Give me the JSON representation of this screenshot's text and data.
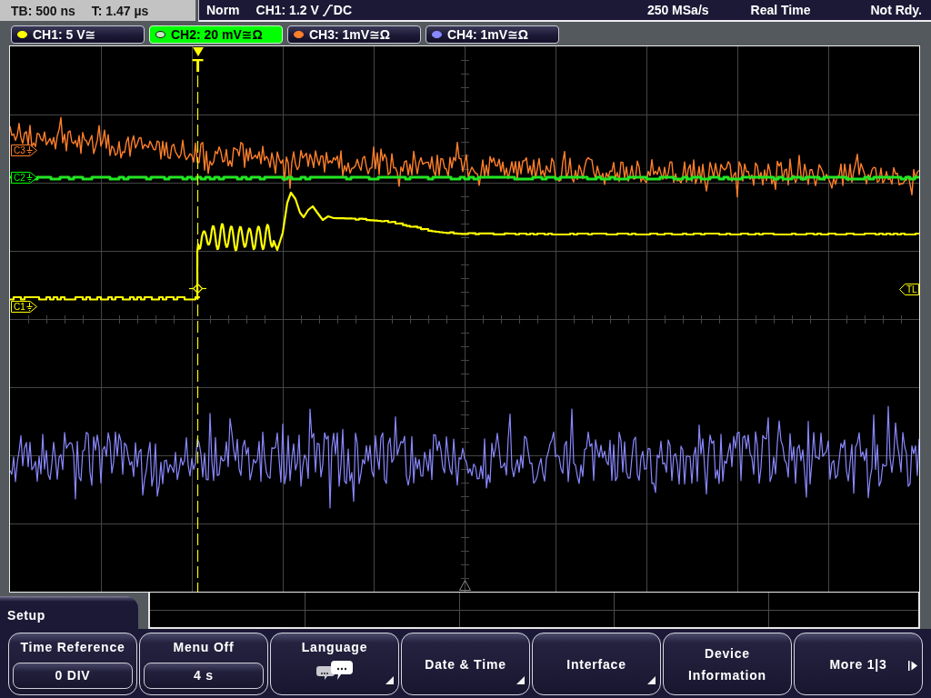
{
  "status_bar": {
    "timebase": "TB: 500 ns",
    "trigger_offset": "T: 1.47 µs",
    "mode": "Norm",
    "trigger": {
      "source_level": "CH1: 1.2 V",
      "coupling": "DC"
    },
    "sample_rate": "250 MSa/s",
    "acquisition": "Real Time",
    "state": "Not Rdy."
  },
  "channels": [
    {
      "label": "CH1: 5 V≅",
      "selected": false,
      "color": "#ffff00"
    },
    {
      "label": "CH2: 20 mV≅Ω",
      "selected": true,
      "color": "#c2e8c2"
    },
    {
      "label": "CH3: 1mV≅Ω",
      "selected": false,
      "color": "#ff7f2a"
    },
    {
      "label": "CH4: 1mV≅Ω",
      "selected": false,
      "color": "#8a88ff"
    }
  ],
  "display": {
    "trigger_marker": "T",
    "channel_markers": [
      {
        "label": "C3",
        "color": "#ff7f2a"
      },
      {
        "label": "C2",
        "color": "#00ff00"
      },
      {
        "label": "C1",
        "color": "#ffff00"
      }
    ],
    "trigger_level_marker": "TL"
  },
  "menu": {
    "title": "Setup",
    "softkeys": [
      {
        "label": "Time Reference",
        "kind": "value",
        "value": "0 DIV"
      },
      {
        "label": "Menu Off",
        "kind": "value",
        "value": "4 s"
      },
      {
        "label": "Language",
        "kind": "icon_submenu"
      },
      {
        "label": "Date & Time",
        "kind": "submenu"
      },
      {
        "label": "Interface",
        "kind": "submenu"
      },
      {
        "label": "Device Information",
        "kind": "action"
      },
      {
        "label": "More 1|3",
        "kind": "next_page"
      }
    ]
  }
}
